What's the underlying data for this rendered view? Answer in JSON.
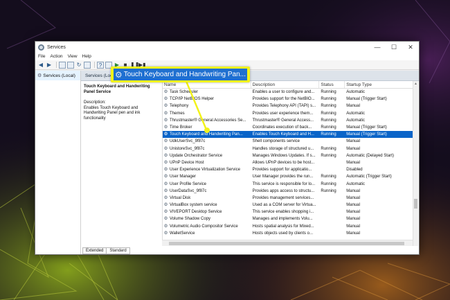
{
  "window": {
    "title": "Services",
    "controls": {
      "minimize": "—",
      "maximize": "☐",
      "close": "✕"
    }
  },
  "menu": [
    "File",
    "Action",
    "View",
    "Help"
  ],
  "toolbar_icons": [
    "back-icon",
    "forward-icon",
    "console-tree-icon",
    "properties-icon",
    "refresh-icon",
    "export-icon",
    "help-icon",
    "start-icon",
    "stop-icon",
    "pause-icon",
    "restart-icon"
  ],
  "tree": {
    "root": "Services (Local)"
  },
  "panel": {
    "header": "Services (Local)",
    "selected_service": "Touch Keyboard and Handwriting Panel Service",
    "description_label": "Description:",
    "description_text": "Enables Touch Keyboard and Handwriting Panel pen and ink functionality"
  },
  "columns": {
    "name": "Name",
    "description": "Description",
    "status": "Status",
    "startup": "Startup Type"
  },
  "services": [
    {
      "name": "Task Scheduler",
      "description": "Enables a user to configure and...",
      "status": "Running",
      "startup": "Automatic"
    },
    {
      "name": "TCP/IP NetBIOS Helper",
      "description": "Provides support for the NetBIO...",
      "status": "Running",
      "startup": "Manual (Trigger Start)"
    },
    {
      "name": "Telephony",
      "description": "Provides Telephony API (TAPI) s...",
      "status": "Running",
      "startup": "Manual"
    },
    {
      "name": "Themes",
      "description": "Provides user experience them...",
      "status": "Running",
      "startup": "Automatic"
    },
    {
      "name": "Thrustmaster® General Accessories Se...",
      "description": "Thrustmaster® General Access...",
      "status": "Running",
      "startup": "Automatic"
    },
    {
      "name": "Time Broker",
      "description": "Coordinates execution of back...",
      "status": "Running",
      "startup": "Manual (Trigger Start)"
    },
    {
      "name": "Touch Keyboard and Handwriting Pan...",
      "description": "Enables Touch Keyboard and H...",
      "status": "Running",
      "startup": "Manual (Trigger Start)"
    },
    {
      "name": "UdkUserSvc_9f87c",
      "description": "Shell components service",
      "status": "",
      "startup": "Manual"
    },
    {
      "name": "UnistoreSvc_9f87c",
      "description": "Handles storage of structured u...",
      "status": "Running",
      "startup": "Manual"
    },
    {
      "name": "Update Orchestrator Service",
      "description": "Manages Windows Updates. If s...",
      "status": "Running",
      "startup": "Automatic (Delayed Start)"
    },
    {
      "name": "UPnP Device Host",
      "description": "Allows UPnP devices to be host...",
      "status": "",
      "startup": "Manual"
    },
    {
      "name": "User Experience Virtualization Service",
      "description": "Provides support for applicatio...",
      "status": "",
      "startup": "Disabled"
    },
    {
      "name": "User Manager",
      "description": "User Manager provides the run...",
      "status": "Running",
      "startup": "Automatic (Trigger Start)"
    },
    {
      "name": "User Profile Service",
      "description": "This service is responsible for lo...",
      "status": "Running",
      "startup": "Automatic"
    },
    {
      "name": "UserDataSvc_9f87c",
      "description": "Provides apps access to structu...",
      "status": "Running",
      "startup": "Manual"
    },
    {
      "name": "Virtual Disk",
      "description": "Provides management services...",
      "status": "",
      "startup": "Manual"
    },
    {
      "name": "VirtualBox system service",
      "description": "Used as a COM server for Virtua...",
      "status": "",
      "startup": "Manual"
    },
    {
      "name": "VIVEPORT Desktop Service",
      "description": "This service enables shopping i...",
      "status": "",
      "startup": "Manual"
    },
    {
      "name": "Volume Shadow Copy",
      "description": "Manages and implements Volu...",
      "status": "",
      "startup": "Manual"
    },
    {
      "name": "Volumetric Audio Compositor Service",
      "description": "Hosts spatial analysis for Mixed...",
      "status": "",
      "startup": "Manual"
    },
    {
      "name": "WalletService",
      "description": "Hosts objects used by clients o...",
      "status": "",
      "startup": "Manual"
    }
  ],
  "selected_index": 6,
  "tabs": [
    "Extended",
    "Standard"
  ],
  "callout": {
    "text": "Touch Keyboard and Handwriting Pan...",
    "color": "#f2f21a"
  }
}
